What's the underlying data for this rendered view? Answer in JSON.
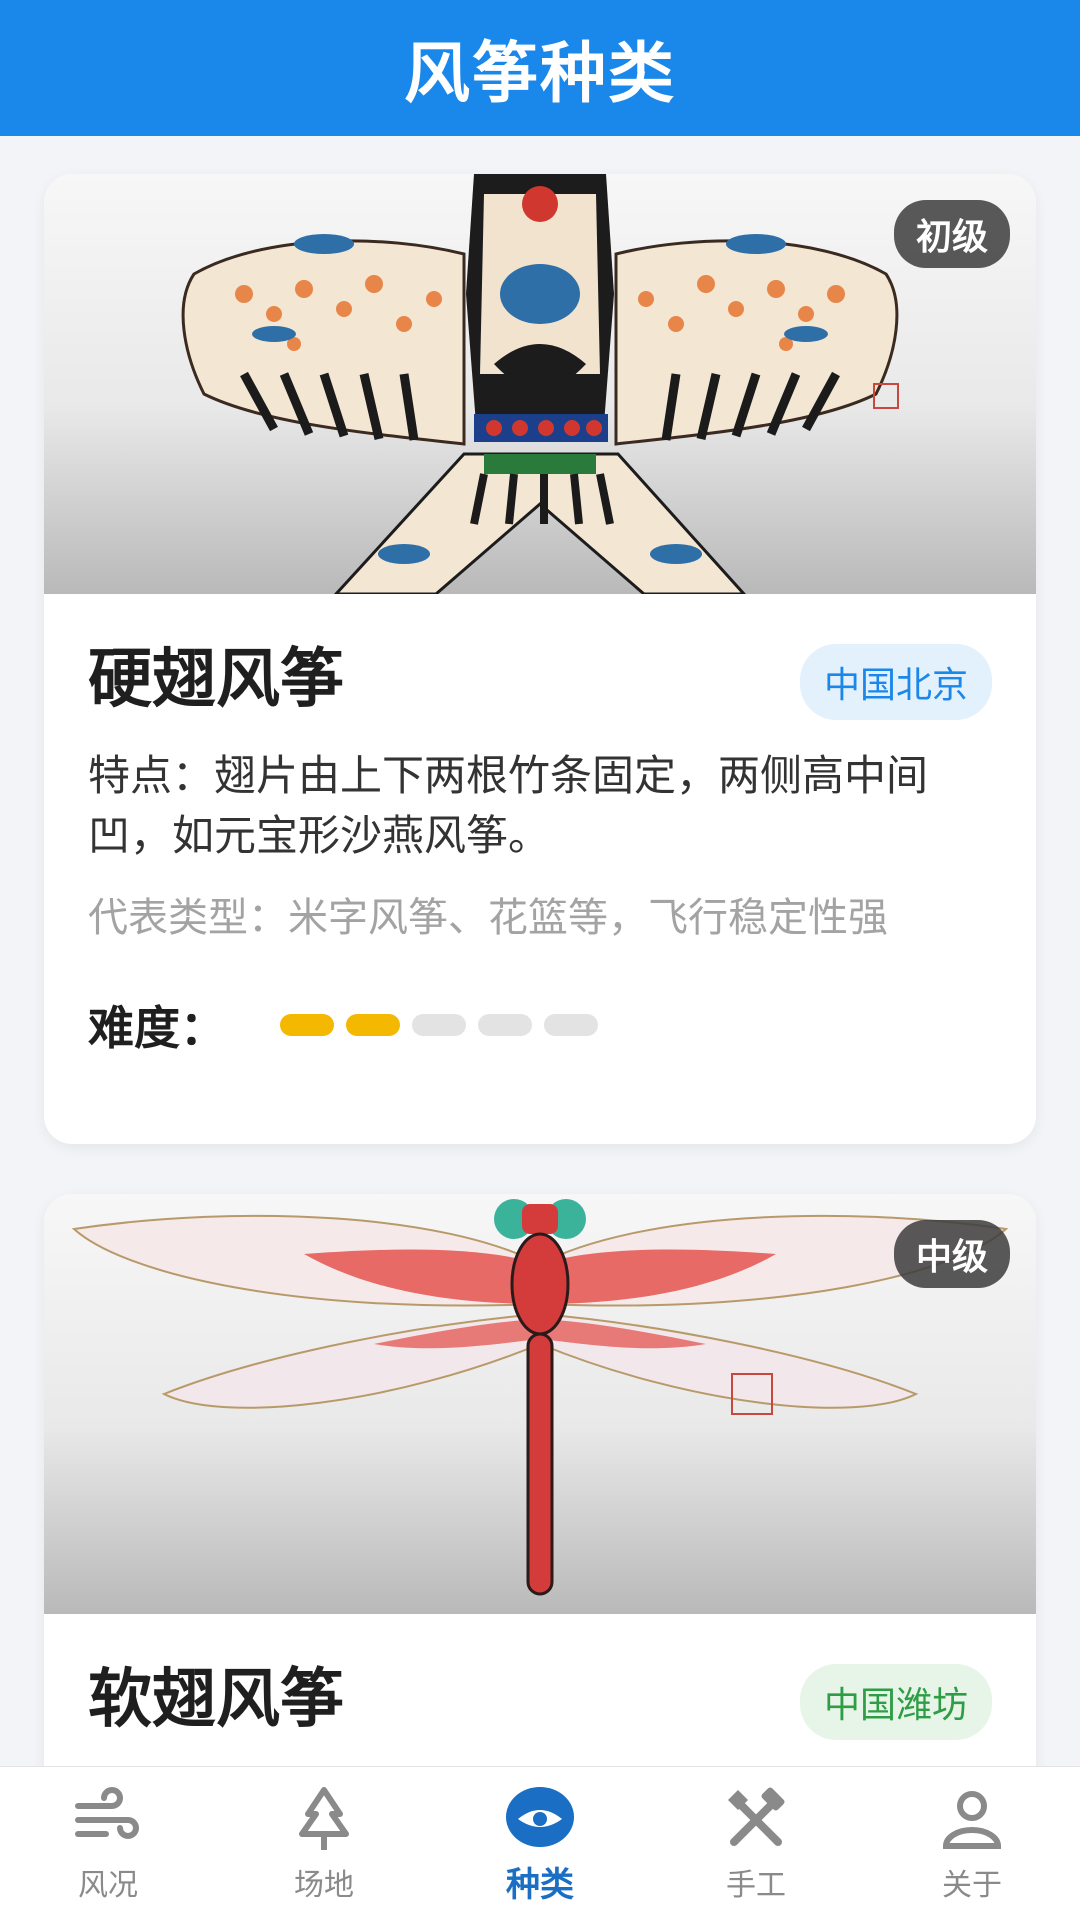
{
  "header": {
    "title": "风筝种类"
  },
  "cards": [
    {
      "level": "初级",
      "title": "硬翅风筝",
      "region": "中国北京",
      "feature": "特点：翅片由上下两根竹条固定，两侧高中间凹，如元宝形沙燕风筝。",
      "representative": "代表类型：米字风筝、花篮等，飞行稳定性强",
      "difficulty_label": "难度：",
      "difficulty_level": 2,
      "difficulty_max": 5
    },
    {
      "level": "中级",
      "title": "软翅风筝",
      "region": "中国潍坊"
    }
  ],
  "tabbar": {
    "items": [
      {
        "label": "风况",
        "icon": "wind-icon"
      },
      {
        "label": "场地",
        "icon": "tree-icon"
      },
      {
        "label": "种类",
        "icon": "kite-eye-icon",
        "active": true
      },
      {
        "label": "手工",
        "icon": "tools-icon"
      },
      {
        "label": "关于",
        "icon": "user-icon"
      }
    ]
  },
  "colors": {
    "header_bg": "#1a87ea",
    "difficulty_on": "#f5b800",
    "difficulty_off": "#e3e3e3",
    "region_blue": "#1a87ea",
    "region_green": "#2e9d45",
    "tab_active": "#1a6ec4"
  }
}
